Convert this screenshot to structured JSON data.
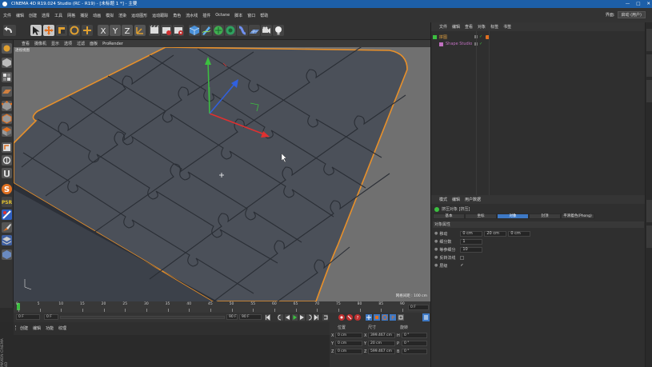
{
  "window": {
    "title": "CINEMA 4D R19.024 Studio (RC - R19) - [未标题 1 *] - 主要",
    "controls": [
      "—",
      "□",
      "✕"
    ]
  },
  "menubar": {
    "items": [
      "文件",
      "编辑",
      "创建",
      "选择",
      "工具",
      "网格",
      "捕捉",
      "动画",
      "模拟",
      "渲染",
      "运动图形",
      "运动跟踪",
      "角色",
      "流水线",
      "插件",
      "Octane",
      "脚本",
      "窗口",
      "帮助"
    ],
    "layout_label": "界面:",
    "layout_value": "启动 (用户)"
  },
  "viewport": {
    "menu": [
      "查看",
      "摄像机",
      "显示",
      "选项",
      "过滤",
      "面板",
      "ProRender"
    ],
    "view_name": "透视视图",
    "grid_spacing": "网格间距 : 100 cm"
  },
  "timeline": {
    "ticks": [
      "0",
      "5",
      "10",
      "15",
      "20",
      "25",
      "30",
      "35",
      "40",
      "45",
      "50",
      "55",
      "60",
      "65",
      "70",
      "75",
      "80",
      "85",
      "90"
    ],
    "end_frame": "0 F"
  },
  "transport": {
    "current": "0 F",
    "start": "0 F",
    "end": "90 F",
    "max": "90 F"
  },
  "material": {
    "tabs": [
      "创建",
      "编辑",
      "功能",
      "纹理"
    ]
  },
  "coords": {
    "headers": [
      "位置",
      "尺寸",
      "旋转"
    ],
    "rows": [
      {
        "axis": "X",
        "pos": "0 cm",
        "size": "399.467 cm",
        "rot_axis": "H",
        "rot": "0 °"
      },
      {
        "axis": "Y",
        "pos": "0 cm",
        "size": "20 cm",
        "rot_axis": "P",
        "rot": "0 °"
      },
      {
        "axis": "Z",
        "pos": "0 cm",
        "size": "599.467 cm",
        "rot_axis": "B",
        "rot": "0 °"
      }
    ],
    "brand": "MAXON CINEMA 4D"
  },
  "object_manager": {
    "menu": [
      "文件",
      "编辑",
      "查看",
      "对象",
      "标签",
      "书签"
    ],
    "objects": [
      {
        "name": "拼图",
        "color": "#e0a040"
      },
      {
        "name": "Shape Studio",
        "color": "#c070c0"
      }
    ]
  },
  "attributes": {
    "menu": [
      "模式",
      "编辑",
      "用户数据"
    ],
    "object_title": "挤压对象 [挤压]",
    "tabs": [
      "基本",
      "坐标",
      "对象",
      "封顶",
      "平滑着色(Phong)"
    ],
    "active_tab": 2,
    "section": "对象属性",
    "props": [
      {
        "label": "移动",
        "values": [
          "0 cm",
          "20 cm",
          "0 cm"
        ]
      },
      {
        "label": "细分数",
        "values": [
          "1"
        ]
      },
      {
        "label": "等参细分",
        "values": [
          "10"
        ]
      },
      {
        "label": "反转法线",
        "values": [
          ""
        ]
      },
      {
        "label": "层级",
        "values": [
          "✓"
        ]
      }
    ]
  },
  "colors": {
    "accent": "#3d78c4",
    "titlebar": "#1d5fa8",
    "puzzle": "#4a4f59",
    "selection": "#e8902a"
  }
}
